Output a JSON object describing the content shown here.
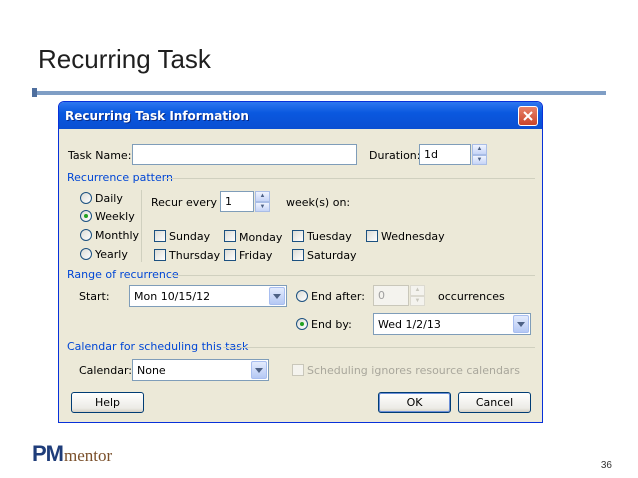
{
  "slide": {
    "title": "Recurring Task",
    "page_number": "36"
  },
  "logo": {
    "bold": "PM",
    "rest": "mentor"
  },
  "dialog": {
    "title": "Recurring Task Information",
    "task_name_label": "Task Name:",
    "task_name_value": "",
    "duration_label": "Duration:",
    "duration_value": "1d",
    "recurrence_section": "Recurrence pattern",
    "patterns": [
      "Daily",
      "Weekly",
      "Monthly",
      "Yearly"
    ],
    "selected_pattern": "Weekly",
    "recur_every_label": "Recur every",
    "recur_every_value": "1",
    "weeks_on_label": "week(s) on:",
    "days": [
      "Sunday",
      "Monday",
      "Tuesday",
      "Wednesday",
      "Thursday",
      "Friday",
      "Saturday"
    ],
    "range_section": "Range of recurrence",
    "start_label": "Start:",
    "start_value": "Mon 10/15/12",
    "end_after_label": "End after:",
    "end_after_value": "0",
    "occurrences_label": "occurrences",
    "end_by_label": "End by:",
    "end_by_value": "Wed 1/2/13",
    "calendar_section": "Calendar for scheduling this task",
    "calendar_label": "Calendar:",
    "calendar_value": "None",
    "ignore_calendars_label": "Scheduling ignores resource calendars",
    "help_button": "Help",
    "ok_button": "OK",
    "cancel_button": "Cancel"
  },
  "colors": {
    "title_bar": "#0a58df",
    "section_text": "#0046d5",
    "accent_rule": "#7f9ec5"
  }
}
